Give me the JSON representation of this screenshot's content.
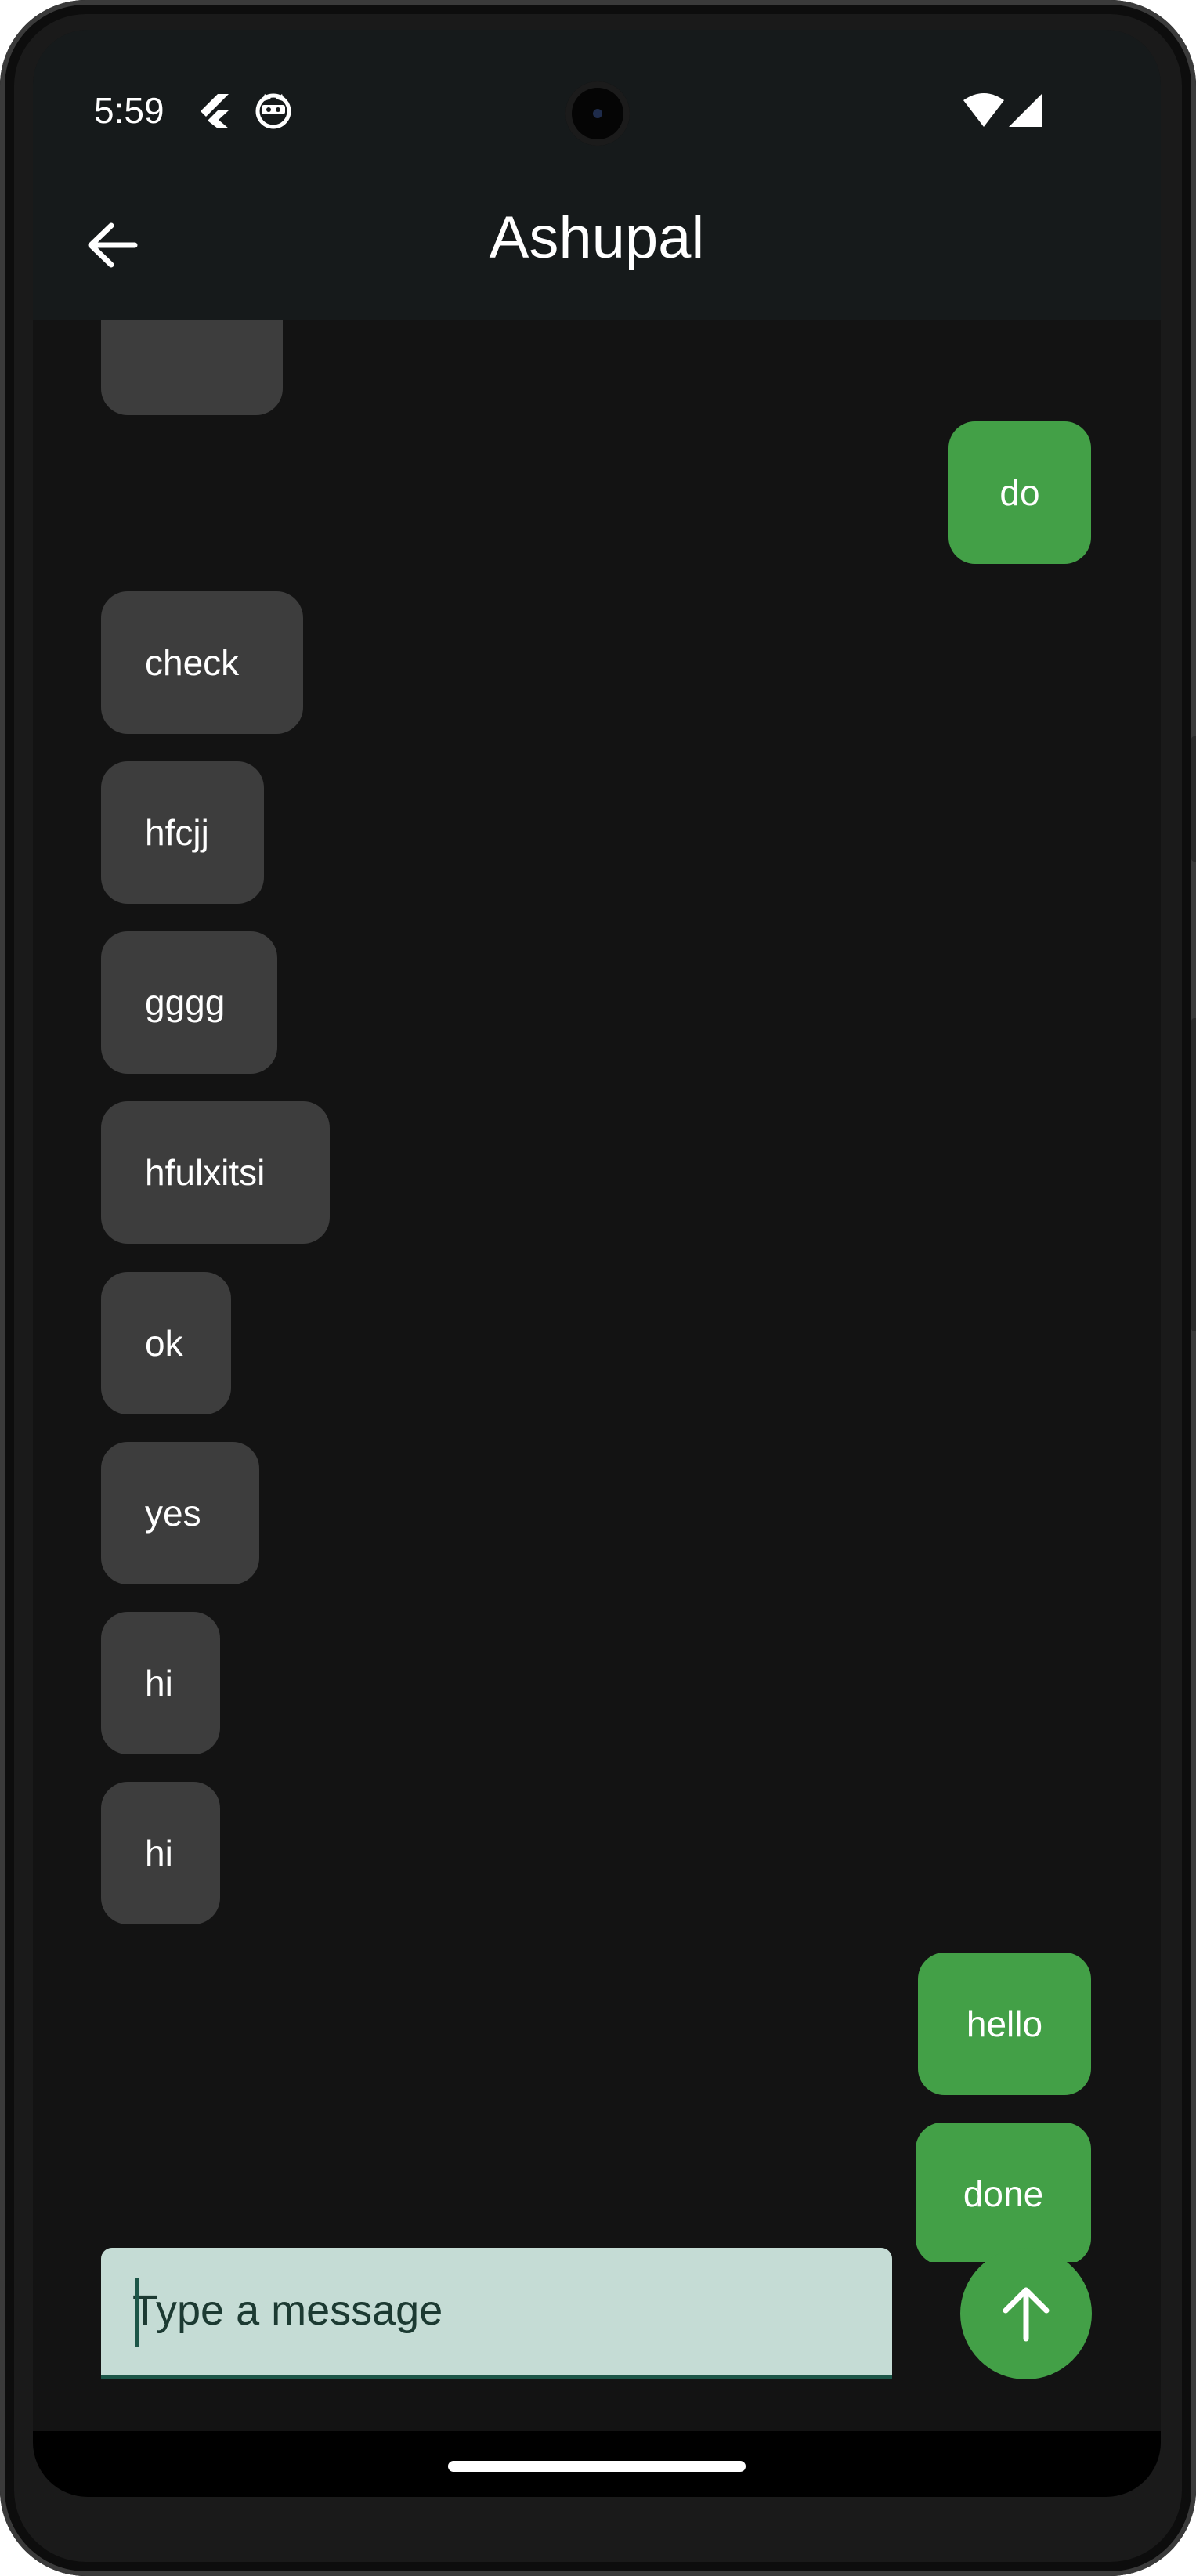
{
  "status_bar": {
    "time": "5:59",
    "icons": [
      "flutter-icon",
      "debug-cat-icon",
      "wifi-icon",
      "cellular-signal-icon"
    ]
  },
  "app_bar": {
    "title": "Ashupal",
    "back_icon": "arrow-back-icon"
  },
  "messages": [
    {
      "text": "",
      "direction": "received"
    },
    {
      "text": "do",
      "direction": "sent"
    },
    {
      "text": "check",
      "direction": "received"
    },
    {
      "text": "hfcjj",
      "direction": "received"
    },
    {
      "text": "gggg",
      "direction": "received"
    },
    {
      "text": "hfulxitsi",
      "direction": "received"
    },
    {
      "text": "ok",
      "direction": "received"
    },
    {
      "text": "yes",
      "direction": "received"
    },
    {
      "text": "hi",
      "direction": "received"
    },
    {
      "text": "hi",
      "direction": "received"
    },
    {
      "text": "hello",
      "direction": "sent"
    },
    {
      "text": "done",
      "direction": "sent"
    }
  ],
  "composer": {
    "placeholder": "Type a message",
    "value": "",
    "send_icon": "arrow-up-icon"
  },
  "colors": {
    "background": "#131313",
    "app_bar": "#161a1b",
    "received_bubble": "#3d3d3d",
    "sent_bubble": "#43a047",
    "input_fill": "#c5dcd5",
    "input_underline": "#1c5648",
    "send_button": "#43a047"
  }
}
